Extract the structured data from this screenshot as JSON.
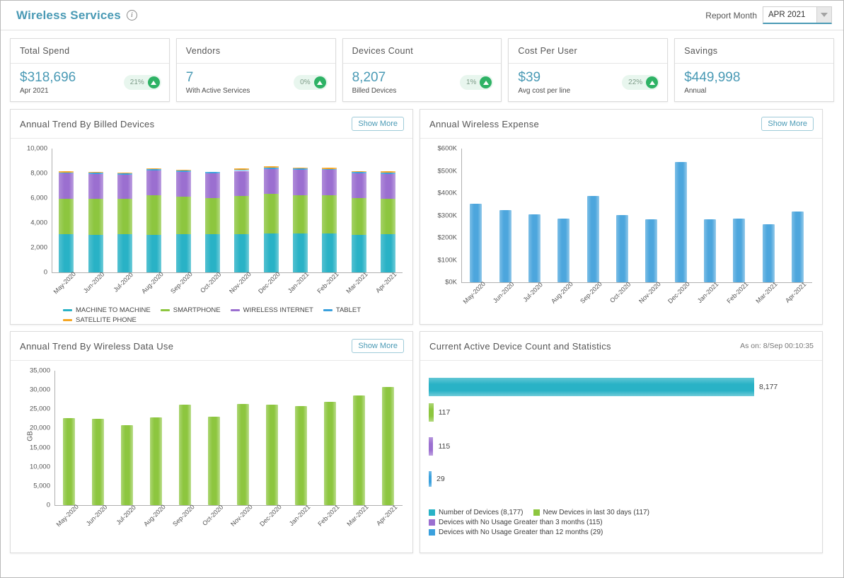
{
  "header": {
    "title": "Wireless Services",
    "info_icon": "info-icon",
    "report_month_label": "Report Month",
    "report_month_value": "APR 2021"
  },
  "kpis": [
    {
      "title": "Total Spend",
      "value": "$318,696",
      "sub": "Apr 2021",
      "pct": "21%",
      "trend": "up"
    },
    {
      "title": "Vendors",
      "value": "7",
      "sub": "With Active Services",
      "pct": "0%",
      "trend": "up"
    },
    {
      "title": "Devices Count",
      "value": "8,207",
      "sub": "Billed Devices",
      "pct": "1%",
      "trend": "up"
    },
    {
      "title": "Cost Per User",
      "value": "$39",
      "sub": "Avg cost per line",
      "pct": "22%",
      "trend": "up"
    },
    {
      "title": "Savings",
      "value": "$449,998",
      "sub": "Annual",
      "pct": "",
      "trend": ""
    }
  ],
  "panels": {
    "billed_devices": {
      "title": "Annual Trend By Billed Devices",
      "show_more": "Show More"
    },
    "wireless_expense": {
      "title": "Annual Wireless Expense",
      "show_more": "Show More"
    },
    "data_use": {
      "title": "Annual Trend By Wireless Data Use",
      "show_more": "Show More"
    },
    "active_devices": {
      "title": "Current Active Device Count and Statistics",
      "as_on": "As on: 8/Sep 00:10:35"
    }
  },
  "colors": {
    "accent": "#4a9ab5",
    "machine_to_machine": "#29b2c6",
    "smartphone": "#8dc63f",
    "wireless_internet": "#9b6fd0",
    "tablet": "#3aa0dd",
    "satellite_phone": "#f5a623",
    "expense_bar": "#4da6dd",
    "data_bar": "#8dc63f",
    "positive_green": "#2eb265"
  },
  "chart_data": [
    {
      "id": "billed_devices",
      "type": "bar",
      "stacked": true,
      "title": "Annual Trend By Billed Devices",
      "xlabel": "",
      "ylabel": "",
      "ylim": [
        0,
        10000
      ],
      "yticks": [
        "0",
        "2,000",
        "4,000",
        "6,000",
        "8,000",
        "10,000"
      ],
      "grid": false,
      "legend_position": "bottom",
      "categories": [
        "May-2020",
        "Jun-2020",
        "Jul-2020",
        "Aug-2020",
        "Sep-2020",
        "Oct-2020",
        "Nov-2020",
        "Dec-2020",
        "Jan-2021",
        "Feb-2021",
        "Mar-2021",
        "Apr-2021"
      ],
      "series": [
        {
          "name": "MACHINE TO MACHINE",
          "color": "#29b2c6",
          "values": [
            3060,
            3050,
            3060,
            3040,
            3100,
            3110,
            3110,
            3120,
            3120,
            3130,
            3050,
            3060
          ]
        },
        {
          "name": "SMARTPHONE",
          "color": "#8dc63f",
          "values": [
            2900,
            2880,
            2880,
            3170,
            3010,
            2880,
            3080,
            3230,
            3130,
            3090,
            2940,
            2900
          ]
        },
        {
          "name": "WIRELESS INTERNET",
          "color": "#9b6fd0",
          "values": [
            2020,
            2010,
            1970,
            2000,
            2020,
            2010,
            2010,
            2020,
            2020,
            2040,
            2010,
            2010
          ]
        },
        {
          "name": "TABLET",
          "color": "#3aa0dd",
          "values": [
            100,
            110,
            110,
            110,
            110,
            110,
            110,
            110,
            110,
            110,
            110,
            110
          ]
        },
        {
          "name": "SATELLITE PHONE",
          "color": "#f5a623",
          "values": [
            70,
            60,
            30,
            70,
            30,
            30,
            70,
            70,
            70,
            60,
            70,
            120
          ]
        }
      ]
    },
    {
      "id": "wireless_expense",
      "type": "bar",
      "title": "Annual Wireless Expense",
      "xlabel": "",
      "ylabel": "",
      "ylim": [
        0,
        600000
      ],
      "yticks": [
        "$0K",
        "$100K",
        "$200K",
        "$300K",
        "$400K",
        "$500K",
        "$600K"
      ],
      "grid": false,
      "categories": [
        "May-2020",
        "Jun-2020",
        "Jul-2020",
        "Aug-2020",
        "Sep-2020",
        "Oct-2020",
        "Nov-2020",
        "Dec-2020",
        "Jan-2021",
        "Feb-2021",
        "Mar-2021",
        "Apr-2021"
      ],
      "values": [
        352000,
        324000,
        306000,
        286000,
        388000,
        301000,
        283000,
        541000,
        283000,
        287000,
        259000,
        317000
      ]
    },
    {
      "id": "data_use",
      "type": "bar",
      "title": "Annual Trend By Wireless Data Use",
      "xlabel": "",
      "ylabel": "GB",
      "ylim": [
        0,
        35000
      ],
      "yticks": [
        "0",
        "5,000",
        "10,000",
        "15,000",
        "20,000",
        "25,000",
        "30,000",
        "35,000"
      ],
      "grid": false,
      "categories": [
        "May-2020",
        "Jun-2020",
        "Jul-2020",
        "Aug-2020",
        "Sep-2020",
        "Oct-2020",
        "Nov-2020",
        "Dec-2020",
        "Jan-2021",
        "Feb-2021",
        "Mar-2021",
        "Apr-2021"
      ],
      "values": [
        22700,
        22400,
        20800,
        22800,
        26100,
        23100,
        26400,
        26200,
        25700,
        26900,
        28500,
        30700
      ]
    },
    {
      "id": "active_devices",
      "type": "bar",
      "orientation": "horizontal",
      "title": "Current Active Device Count and Statistics",
      "xlim": [
        0,
        8177
      ],
      "categories": [
        "Number of Devices (8,177)",
        "New Devices in last 30 days (117)",
        "Devices with No Usage Greater than 3 months (115)",
        "Devices with No Usage Greater than 12 months (29)"
      ],
      "values": [
        8177,
        117,
        115,
        29
      ],
      "value_labels": [
        "8,177",
        "117",
        "115",
        "29"
      ],
      "colors": [
        "#29b2c6",
        "#8dc63f",
        "#9b6fd0",
        "#3aa0dd"
      ]
    }
  ]
}
